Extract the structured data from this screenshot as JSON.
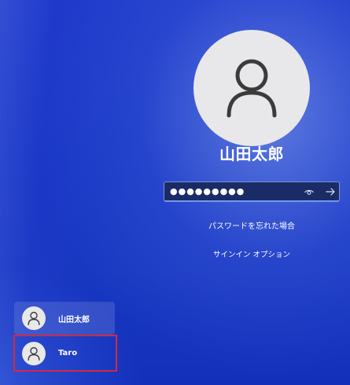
{
  "login": {
    "username": "山田太郎",
    "password_masked": "●●●●●●●●●",
    "forgot_password": "パスワードを忘れた場合",
    "signin_options": "サインイン オプション",
    "icons": {
      "avatar": "person-icon",
      "reveal": "eye-icon",
      "submit": "arrow-right-icon"
    }
  },
  "users": [
    {
      "name": "山田太郎",
      "selected": false
    },
    {
      "name": "Taro",
      "selected": false,
      "highlighted": true
    }
  ],
  "colors": {
    "background": "#1633c7",
    "avatar_bg": "#e8e8ea",
    "avatar_glyph": "#3b3b3b",
    "highlight_border": "#d32a3e"
  }
}
